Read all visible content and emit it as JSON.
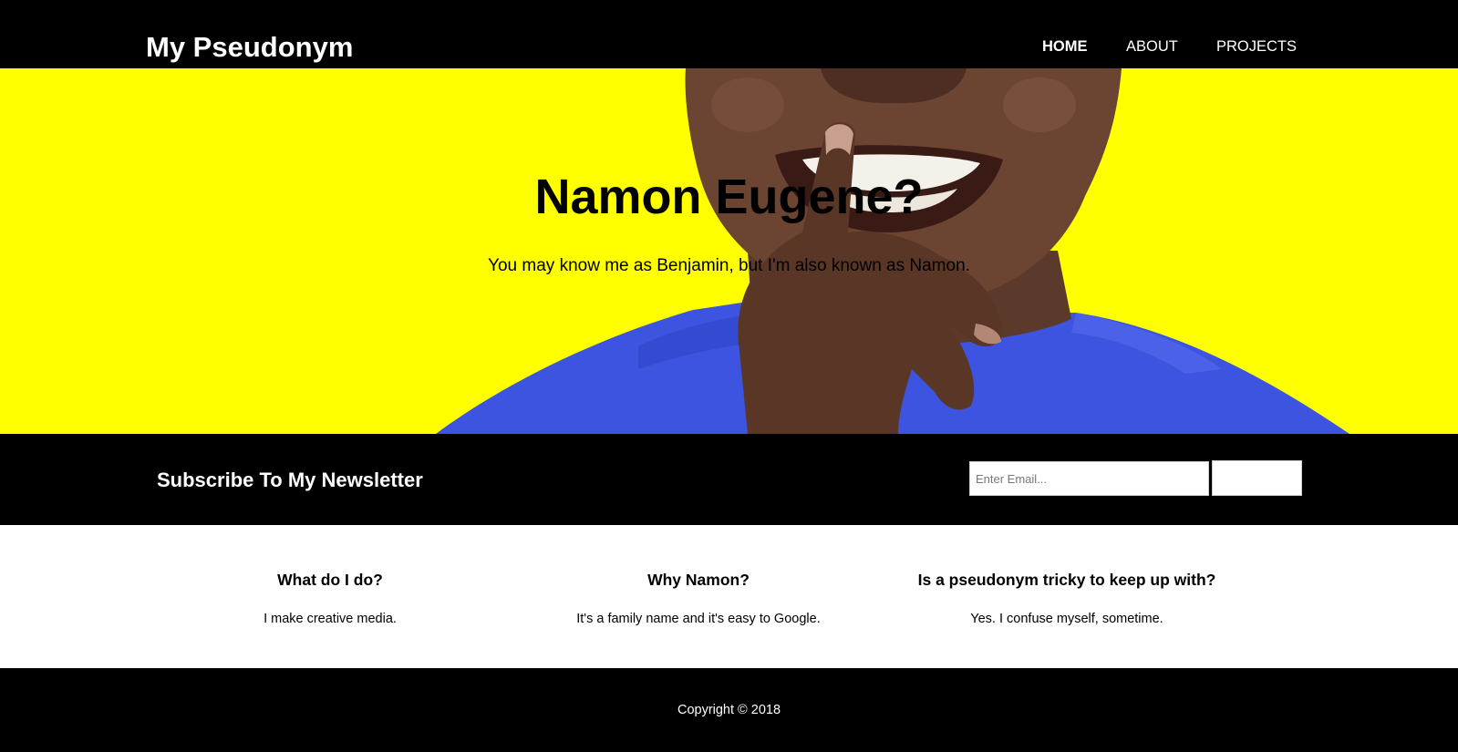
{
  "header": {
    "logo": "My Pseudonym",
    "nav": [
      {
        "label": "HOME",
        "active": true
      },
      {
        "label": "ABOUT",
        "active": false
      },
      {
        "label": "PROJECTS",
        "active": false
      }
    ]
  },
  "hero": {
    "title": "Namon Eugene?",
    "subtitle": "You may know me as Benjamin, but I'm also known as Namon.",
    "background_color": "#ffff00"
  },
  "newsletter": {
    "title": "Subscribe To My Newsletter",
    "email_placeholder": "Enter Email...",
    "button_label": ""
  },
  "features": [
    {
      "title": "What do I do?",
      "text": "I make creative media."
    },
    {
      "title": "Why Namon?",
      "text": "It's a family name and it's easy to Google."
    },
    {
      "title": "Is a pseudonym tricky to keep up with?",
      "text": "Yes. I confuse myself, sometime."
    }
  ],
  "footer": {
    "copyright": "Copyright © 2018"
  },
  "colors": {
    "accent_yellow": "#ffff00",
    "shirt_blue": "#3d54e0",
    "dark": "#000000"
  }
}
